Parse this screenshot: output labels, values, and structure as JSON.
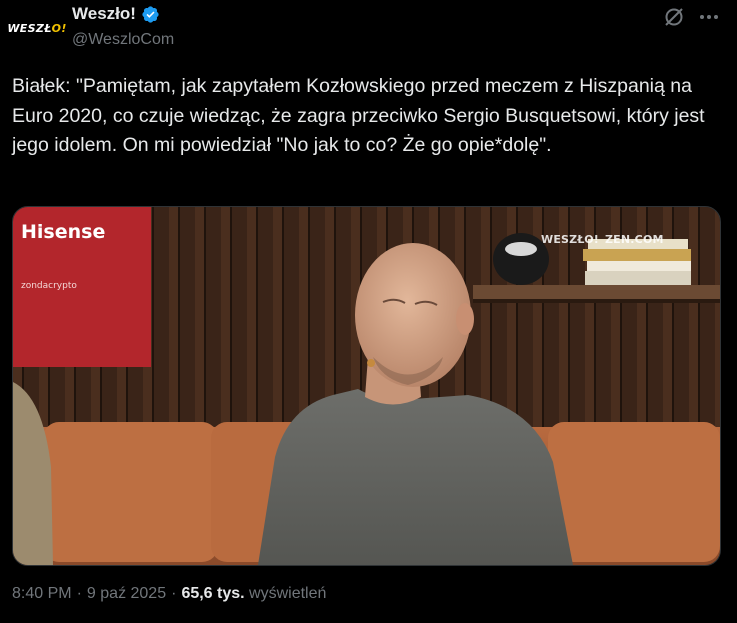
{
  "author": {
    "avatar_text_main": "WESZŁ",
    "avatar_text_accent": "O!",
    "display_name": "Weszło!",
    "handle": "@WeszloCom"
  },
  "tweet": {
    "text": "Białek: \"Pamiętam, jak zapytałem Kozłowskiego przed meczem z Hiszpanią na Euro 2020, co czuje wiedząc, że zagra przeciwko Sergio Busquetsowi, który jest jego idolem. On mi powiedział \"No jak to co? Że go opie*dolę\"."
  },
  "media": {
    "sign_text": "Hisense",
    "sign_subtext": "zondacrypto",
    "watermark_brand": "WESZŁO!",
    "watermark_partner": "ZEN.COM"
  },
  "meta": {
    "time": "8:40 PM",
    "date": "9 paź 2025",
    "views_count": "65,6 tys.",
    "views_label": "wyświetleń"
  },
  "colors": {
    "background": "#000000",
    "text": "#e7e9ea",
    "secondary": "#71767b",
    "verified": "#1d9bf0",
    "border": "#2f3336"
  },
  "icons": {
    "verified": "verified-badge-icon",
    "grok": "grok-icon",
    "more": "more-icon"
  }
}
